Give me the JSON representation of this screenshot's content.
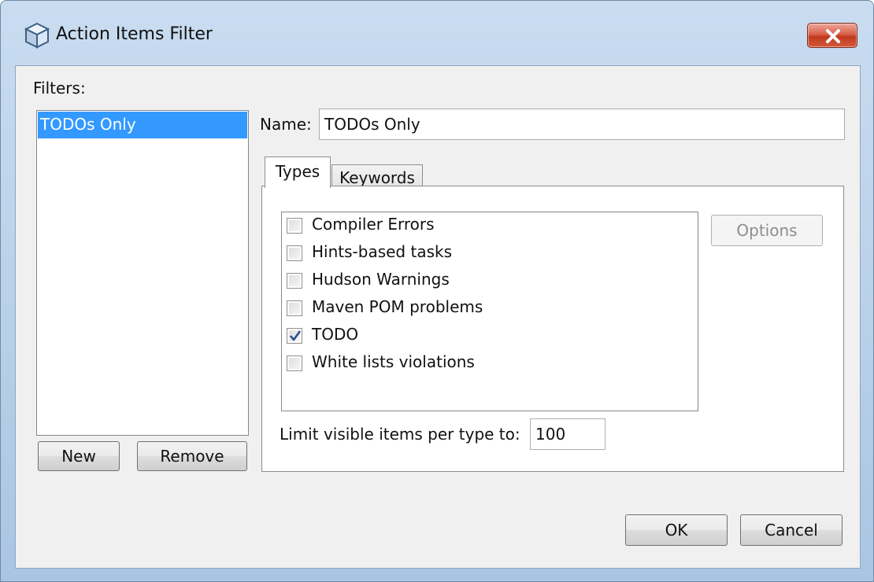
{
  "window": {
    "title": "Action Items Filter",
    "close_icon": "close-x-icon",
    "app_icon": "netbeans-cube-icon"
  },
  "filters": {
    "label": "Filters:",
    "items": [
      {
        "label": "TODOs Only",
        "selected": true
      }
    ],
    "new_label": "New",
    "remove_label": "Remove"
  },
  "name": {
    "label": "Name:",
    "value": "TODOs Only"
  },
  "tabs": [
    {
      "label": "Types",
      "active": true
    },
    {
      "label": "Keywords",
      "active": false
    }
  ],
  "types": {
    "items": [
      {
        "label": "Compiler Errors",
        "checked": false
      },
      {
        "label": "Hints-based tasks",
        "checked": false
      },
      {
        "label": "Hudson Warnings",
        "checked": false
      },
      {
        "label": "Maven POM problems",
        "checked": false
      },
      {
        "label": "TODO",
        "checked": true
      },
      {
        "label": "White lists violations",
        "checked": false
      }
    ],
    "options_label": "Options",
    "limit_label": "Limit visible items per type to:",
    "limit_value": "100"
  },
  "footer": {
    "ok_label": "OK",
    "cancel_label": "Cancel"
  },
  "colors": {
    "selection": "#3399ff",
    "close_button": "#c2391f"
  }
}
